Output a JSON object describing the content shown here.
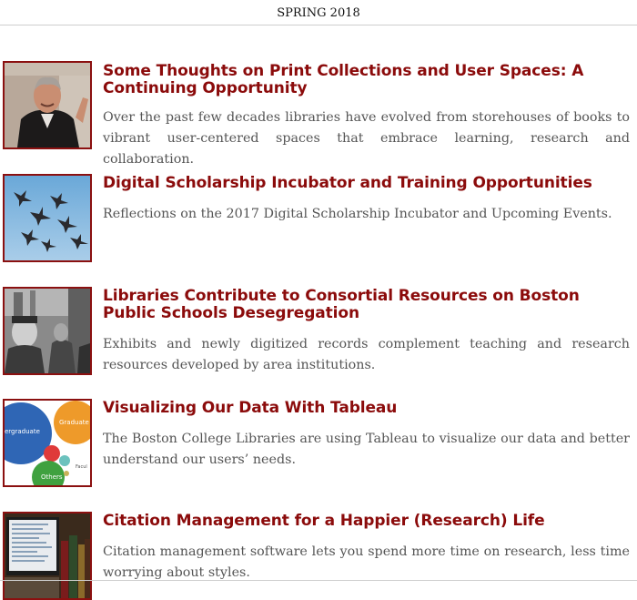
{
  "issue": "SPRING 2018",
  "articles": [
    {
      "title": "Some Thoughts on Print Collections and User Spaces: A Continuing Opportunity",
      "description": "Over the past few decades libraries have evolved from storehouses of books to vibrant user-centered spaces that embrace learning, research and collaboration."
    },
    {
      "title": "Digital Scholarship Incubator and Training Opportunities",
      "description": "Reflections on the 2017 Digital Scholarship Incubator and Upcoming Events."
    },
    {
      "title": "Libraries Contribute to Consortial Resources on Boston Public Schools Desegregation",
      "description": "Exhibits and newly digitized records complement teaching and research resources developed by area institutions."
    },
    {
      "title": "Visualizing Our Data With Tableau",
      "description": "The Boston College Libraries are using Tableau to visualize our data and better understand our users’ needs.",
      "chart_labels": [
        "ergraduate",
        "Graduate",
        "Others",
        "Facul"
      ]
    },
    {
      "title": "Citation Management for a Happier (Research) Life",
      "description": "Citation management software lets you spend more time on research, less time worrying about styles."
    }
  ],
  "colors": {
    "accent": "#8b0b0b",
    "text": "#555555"
  }
}
